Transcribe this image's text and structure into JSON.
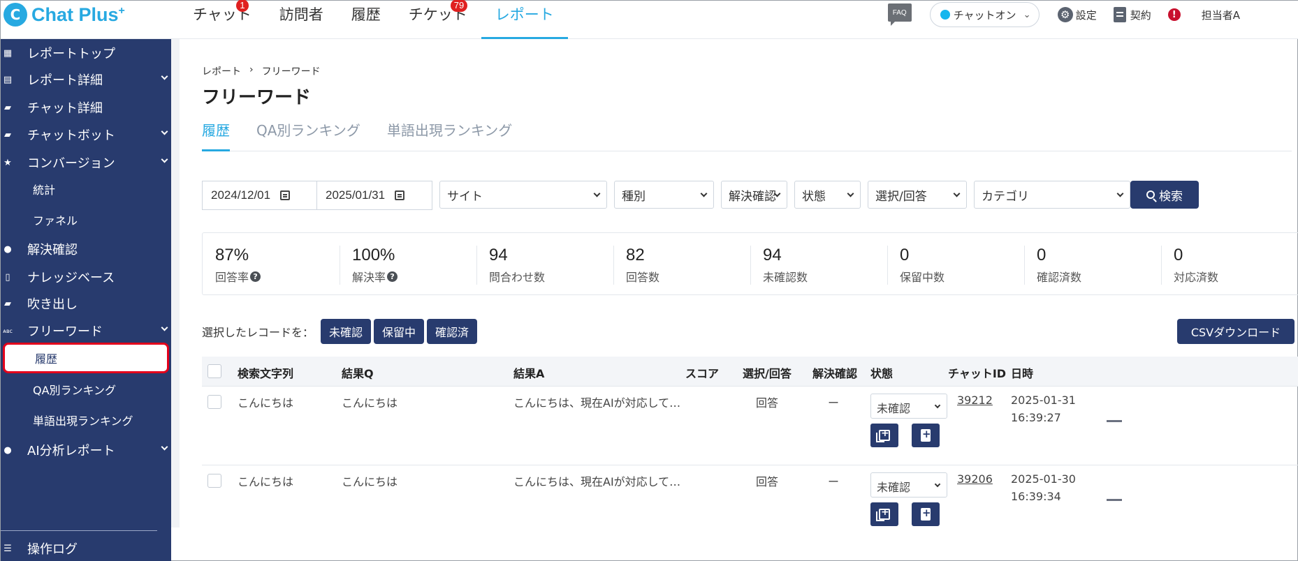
{
  "app": {
    "logo_mark": "C",
    "logo_text": "Chat Plus",
    "logo_sup": "+"
  },
  "topnav": [
    {
      "label": "チャット",
      "badge": "1"
    },
    {
      "label": "訪問者",
      "badge": ""
    },
    {
      "label": "履歴",
      "badge": ""
    },
    {
      "label": "チケット",
      "badge": "79"
    },
    {
      "label": "レポート",
      "badge": "",
      "active": true
    }
  ],
  "topright": {
    "faq": "FAQ",
    "status": "チャットオン",
    "settings": "設定",
    "contract": "契約",
    "alert": "!",
    "user": "担当者A"
  },
  "sidebar": {
    "items": [
      {
        "label": "レポートトップ",
        "icon": "dashboard-icon",
        "glyph": "▦"
      },
      {
        "label": "レポート詳細",
        "icon": "report-icon",
        "glyph": "▤"
      },
      {
        "label": "チャット詳細",
        "icon": "chat-icon",
        "glyph": "▰"
      },
      {
        "label": "チャットボット",
        "icon": "bot-icon",
        "glyph": "▰"
      },
      {
        "label": "コンバージョン",
        "icon": "star-icon",
        "glyph": "★"
      },
      {
        "label": "解決確認",
        "icon": "bulb-icon",
        "glyph": "●"
      },
      {
        "label": "ナレッジベース",
        "icon": "book-icon",
        "glyph": "▯"
      },
      {
        "label": "吹き出し",
        "icon": "balloon-icon",
        "glyph": "▰"
      },
      {
        "label": "フリーワード",
        "icon": "abc-icon",
        "glyph": "ᴀʙᴄ"
      },
      {
        "label": "AI分析レポート",
        "icon": "ai-bulb-icon",
        "glyph": "●"
      },
      {
        "label": "操作ログ",
        "icon": "list-icon",
        "glyph": "☰"
      }
    ],
    "sub": {
      "conversion_stats": "統計",
      "conversion_funnel": "ファネル",
      "freeword_history": "履歴",
      "freeword_qa_ranking": "QA別ランキング",
      "freeword_word_ranking": "単語出現ランキング"
    }
  },
  "breadcrumb": {
    "parent": "レポート",
    "sep": "›",
    "current": "フリーワード"
  },
  "page_title": "フリーワード",
  "tabs": [
    "履歴",
    "QA別ランキング",
    "単語出現ランキング"
  ],
  "filters": {
    "date_from": "2024/12/01",
    "date_to": "2025/01/31",
    "site": "サイト",
    "type": "種別",
    "resolved": "解決確認",
    "state": "状態",
    "choice": "選択/回答",
    "category": "カテゴリ",
    "search": "検索"
  },
  "stats": [
    {
      "value": "87%",
      "label": "回答率",
      "help": true
    },
    {
      "value": "100%",
      "label": "解決率",
      "help": true
    },
    {
      "value": "94",
      "label": "問合わせ数"
    },
    {
      "value": "82",
      "label": "回答数"
    },
    {
      "value": "94",
      "label": "未確認数"
    },
    {
      "value": "0",
      "label": "保留中数"
    },
    {
      "value": "0",
      "label": "確認済数"
    },
    {
      "value": "0",
      "label": "対応済数"
    }
  ],
  "bulk": {
    "label": "選択したレコードを：",
    "unconfirmed": "未確認",
    "pending": "保留中",
    "confirmed": "確認済",
    "csv": "CSVダウンロード"
  },
  "table": {
    "headers": {
      "query": "検索文字列",
      "result_q": "結果Q",
      "result_a": "結果A",
      "score": "スコア",
      "choice": "選択/回答",
      "resolved": "解決確認",
      "state": "状態",
      "chat_id": "チャットID",
      "datetime": "日時"
    },
    "rows": [
      {
        "query": "こんにちは",
        "result_q": "こんにちは",
        "result_a": "こんにちは、現在AIが対応して…",
        "score": "",
        "choice": "回答",
        "resolved": "ー",
        "state": "未確認",
        "chat_id": "39212",
        "date": "2025-01-31",
        "time": "16:39:27"
      },
      {
        "query": "こんにちは",
        "result_q": "こんにちは",
        "result_a": "こんにちは、現在AIが対応して…",
        "score": "",
        "choice": "回答",
        "resolved": "ー",
        "state": "未確認",
        "chat_id": "39206",
        "date": "2025-01-30",
        "time": "16:39:34"
      }
    ]
  }
}
